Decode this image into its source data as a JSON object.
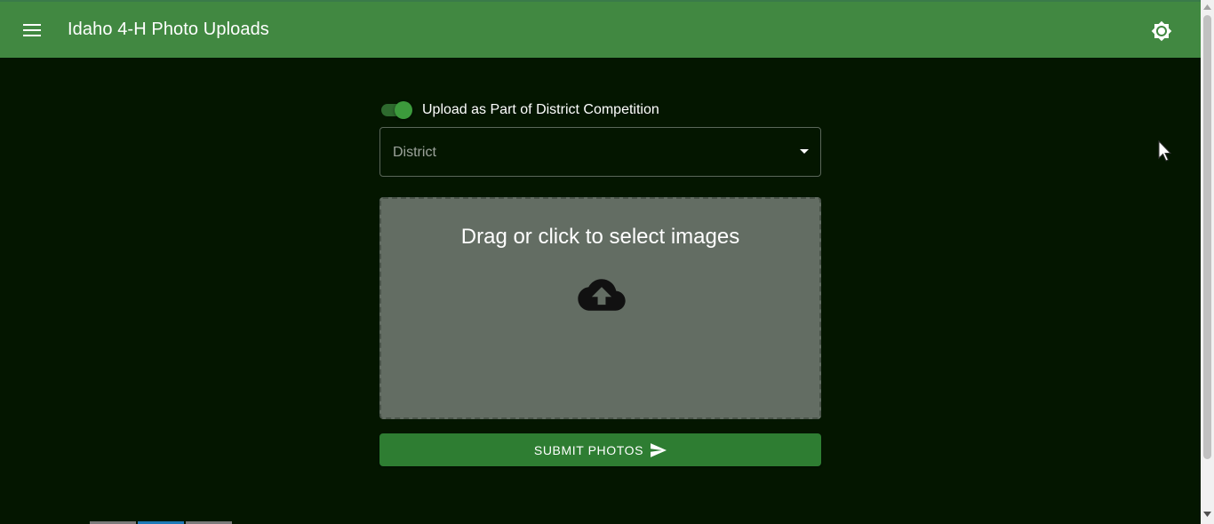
{
  "header": {
    "title": "Idaho 4-H Photo Uploads",
    "menu_icon": "menu-icon",
    "theme_icon": "brightness-icon"
  },
  "form": {
    "district_toggle": {
      "label": "Upload as Part of District Competition",
      "checked": true
    },
    "district_select": {
      "label": "District",
      "icon": "dropdown-arrow-icon"
    },
    "dropzone": {
      "text": "Drag or click to select images",
      "icon": "cloud-upload-icon"
    },
    "submit": {
      "label": "SUBMIT PHOTOS",
      "icon": "send-icon"
    }
  },
  "colors": {
    "appbar": "#418841",
    "background": "#041600",
    "primary": "#2e7d32",
    "dropzone": "#636d63"
  }
}
